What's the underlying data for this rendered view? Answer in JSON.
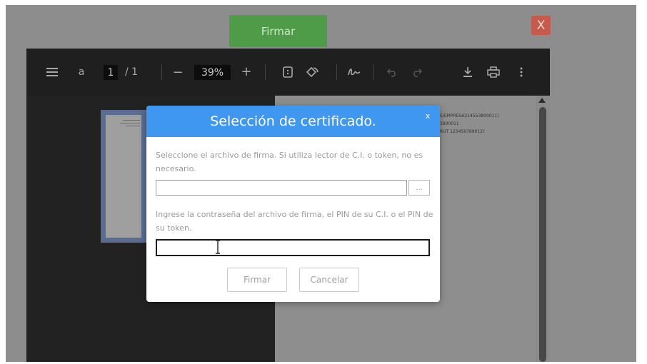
{
  "header": {
    "sign_button": "Firmar",
    "close_button": "X"
  },
  "pdf_toolbar": {
    "menu_icon": "hamburger-icon",
    "text_tool": "a",
    "current_page": "1",
    "page_separator": "/ 1",
    "zoom_out": "−",
    "zoom_level": "39%",
    "zoom_in": "+"
  },
  "document": {
    "lines": [
      "S/EMPRESA214553800011)",
      "3800011",
      "RUT 123456789012)"
    ]
  },
  "modal": {
    "title": "Selección de certificado.",
    "close": "x",
    "file_label": "Seleccione el archivo de firma. Si utiliza lector de C.I. o token, no es necesario.",
    "file_value": "",
    "browse_label": "...",
    "password_label": "Ingrese la contraseña del archivo de firma, el PIN de su C.I. o el PIN de su token.",
    "password_value": "",
    "sign_button": "Firmar",
    "cancel_button": "Cancelar"
  }
}
